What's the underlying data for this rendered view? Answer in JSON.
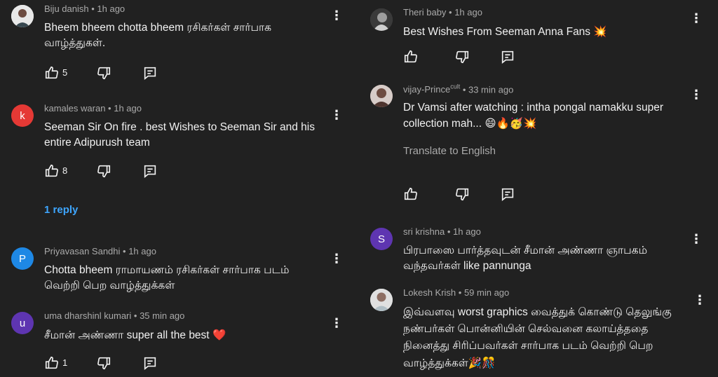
{
  "left": [
    {
      "author": "Biju danish",
      "time": "1h ago",
      "text": "Bheem bheem chotta bheem ரசிகர்கள் சார்பாக வாழ்த்துகள்.",
      "likes": "5",
      "avatar_color": "#e8e8e8",
      "avatar_letter": ""
    },
    {
      "author": "kamales waran",
      "time": "1h ago",
      "text": "Seeman Sir On fire . best Wishes to Seeman Sir and his entire Adipurush team",
      "likes": "8",
      "avatar_color": "#e53935",
      "avatar_letter": "k",
      "replies": "1 reply"
    },
    {
      "author": "Priyavasan Sandhi",
      "time": "1h ago",
      "text": "Chotta bheem ராமாயணம் ரசிகர்கள் சார்பாக படம் வெற்றி பெற வாழ்த்துக்கள்",
      "avatar_color": "#1e88e5",
      "avatar_letter": "P"
    },
    {
      "author": "uma dharshinl kumari",
      "time": "35 min ago",
      "text": "சீமான் அண்ணா super all the best",
      "emoji": "❤️",
      "likes": "1",
      "avatar_color": "#5e35b1",
      "avatar_letter": "u"
    }
  ],
  "right": [
    {
      "author": "Theri baby",
      "time": "1h ago",
      "text": "Best Wishes From Seeman Anna Fans",
      "emoji": "💥",
      "avatar_color": "#555555",
      "avatar_letter": ""
    },
    {
      "author": "vijay-Prince",
      "author_sup": "cult",
      "time": "33 min ago",
      "text": "Dr Vamsi after watching : intha pongal namakku super collection mah...",
      "emoji": "😄🔥🥳💥",
      "translate": "Translate to English",
      "avatar_color": "#8d6e63",
      "avatar_letter": ""
    },
    {
      "author": "sri krishna",
      "time": "1h ago",
      "text": "பிரபாஸை பார்த்தவுடன் சீமான் அண்ணா ஞாபகம் வந்தவர்கள் like pannunga",
      "avatar_color": "#5e35b1",
      "avatar_letter": "S"
    },
    {
      "author": "Lokesh Krish",
      "time": "59 min ago",
      "text": "இவ்வளவு worst graphics வைத்துக் கொண்டு தெலுங்கு நண்பர்கள் பொன்னியின் செல்வனை கலாய்த்ததை நினைத்து சிரிப்பவர்கள் சார்பாக படம் வெற்றி பெற வாழ்த்துக்கள்",
      "emoji": "🎉🎊",
      "avatar_color": "#cfd8dc",
      "avatar_letter": ""
    }
  ],
  "colors": {
    "background": "#212121",
    "text": "#f1f1f1",
    "meta": "#aaaaaa",
    "link": "#3ea6ff"
  },
  "icons": [
    "like-icon",
    "dislike-icon",
    "reply-icon",
    "kebab-icon"
  ]
}
